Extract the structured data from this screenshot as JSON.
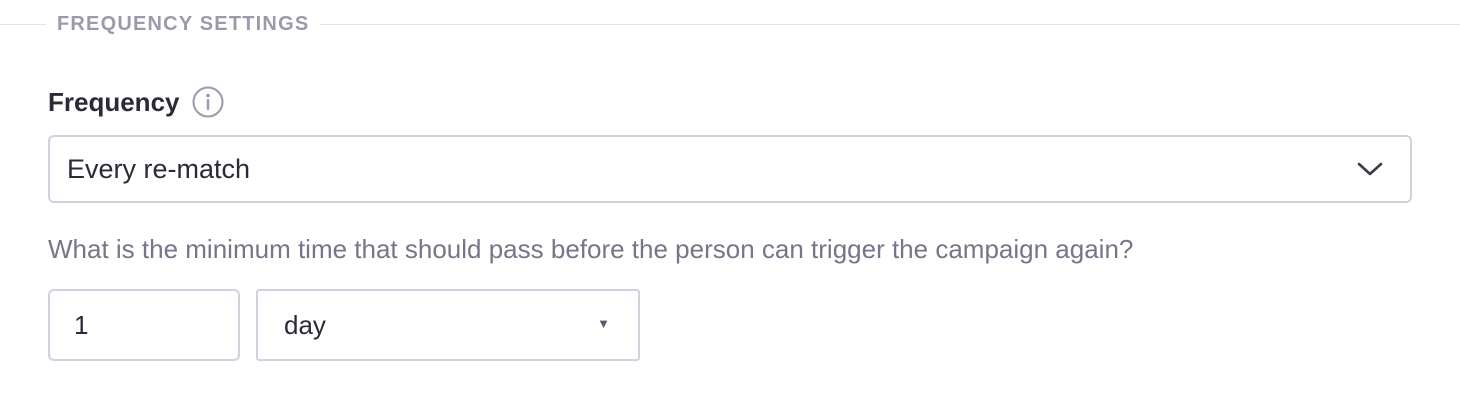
{
  "section": {
    "title": "FREQUENCY SETTINGS"
  },
  "frequency": {
    "label": "Frequency",
    "info_icon": "info-circle-icon",
    "selected": "Every re-match",
    "dropdown_icon": "chevron-down-icon"
  },
  "min_time": {
    "question": "What is the minimum time that should pass before the person can trigger the campaign again?",
    "amount": "1",
    "unit": "day",
    "unit_icon": "caret-down-icon"
  },
  "colors": {
    "border": "#d2d2de",
    "label": "#2a2a38",
    "muted": "#76768a",
    "section_title": "#9a9aab"
  }
}
